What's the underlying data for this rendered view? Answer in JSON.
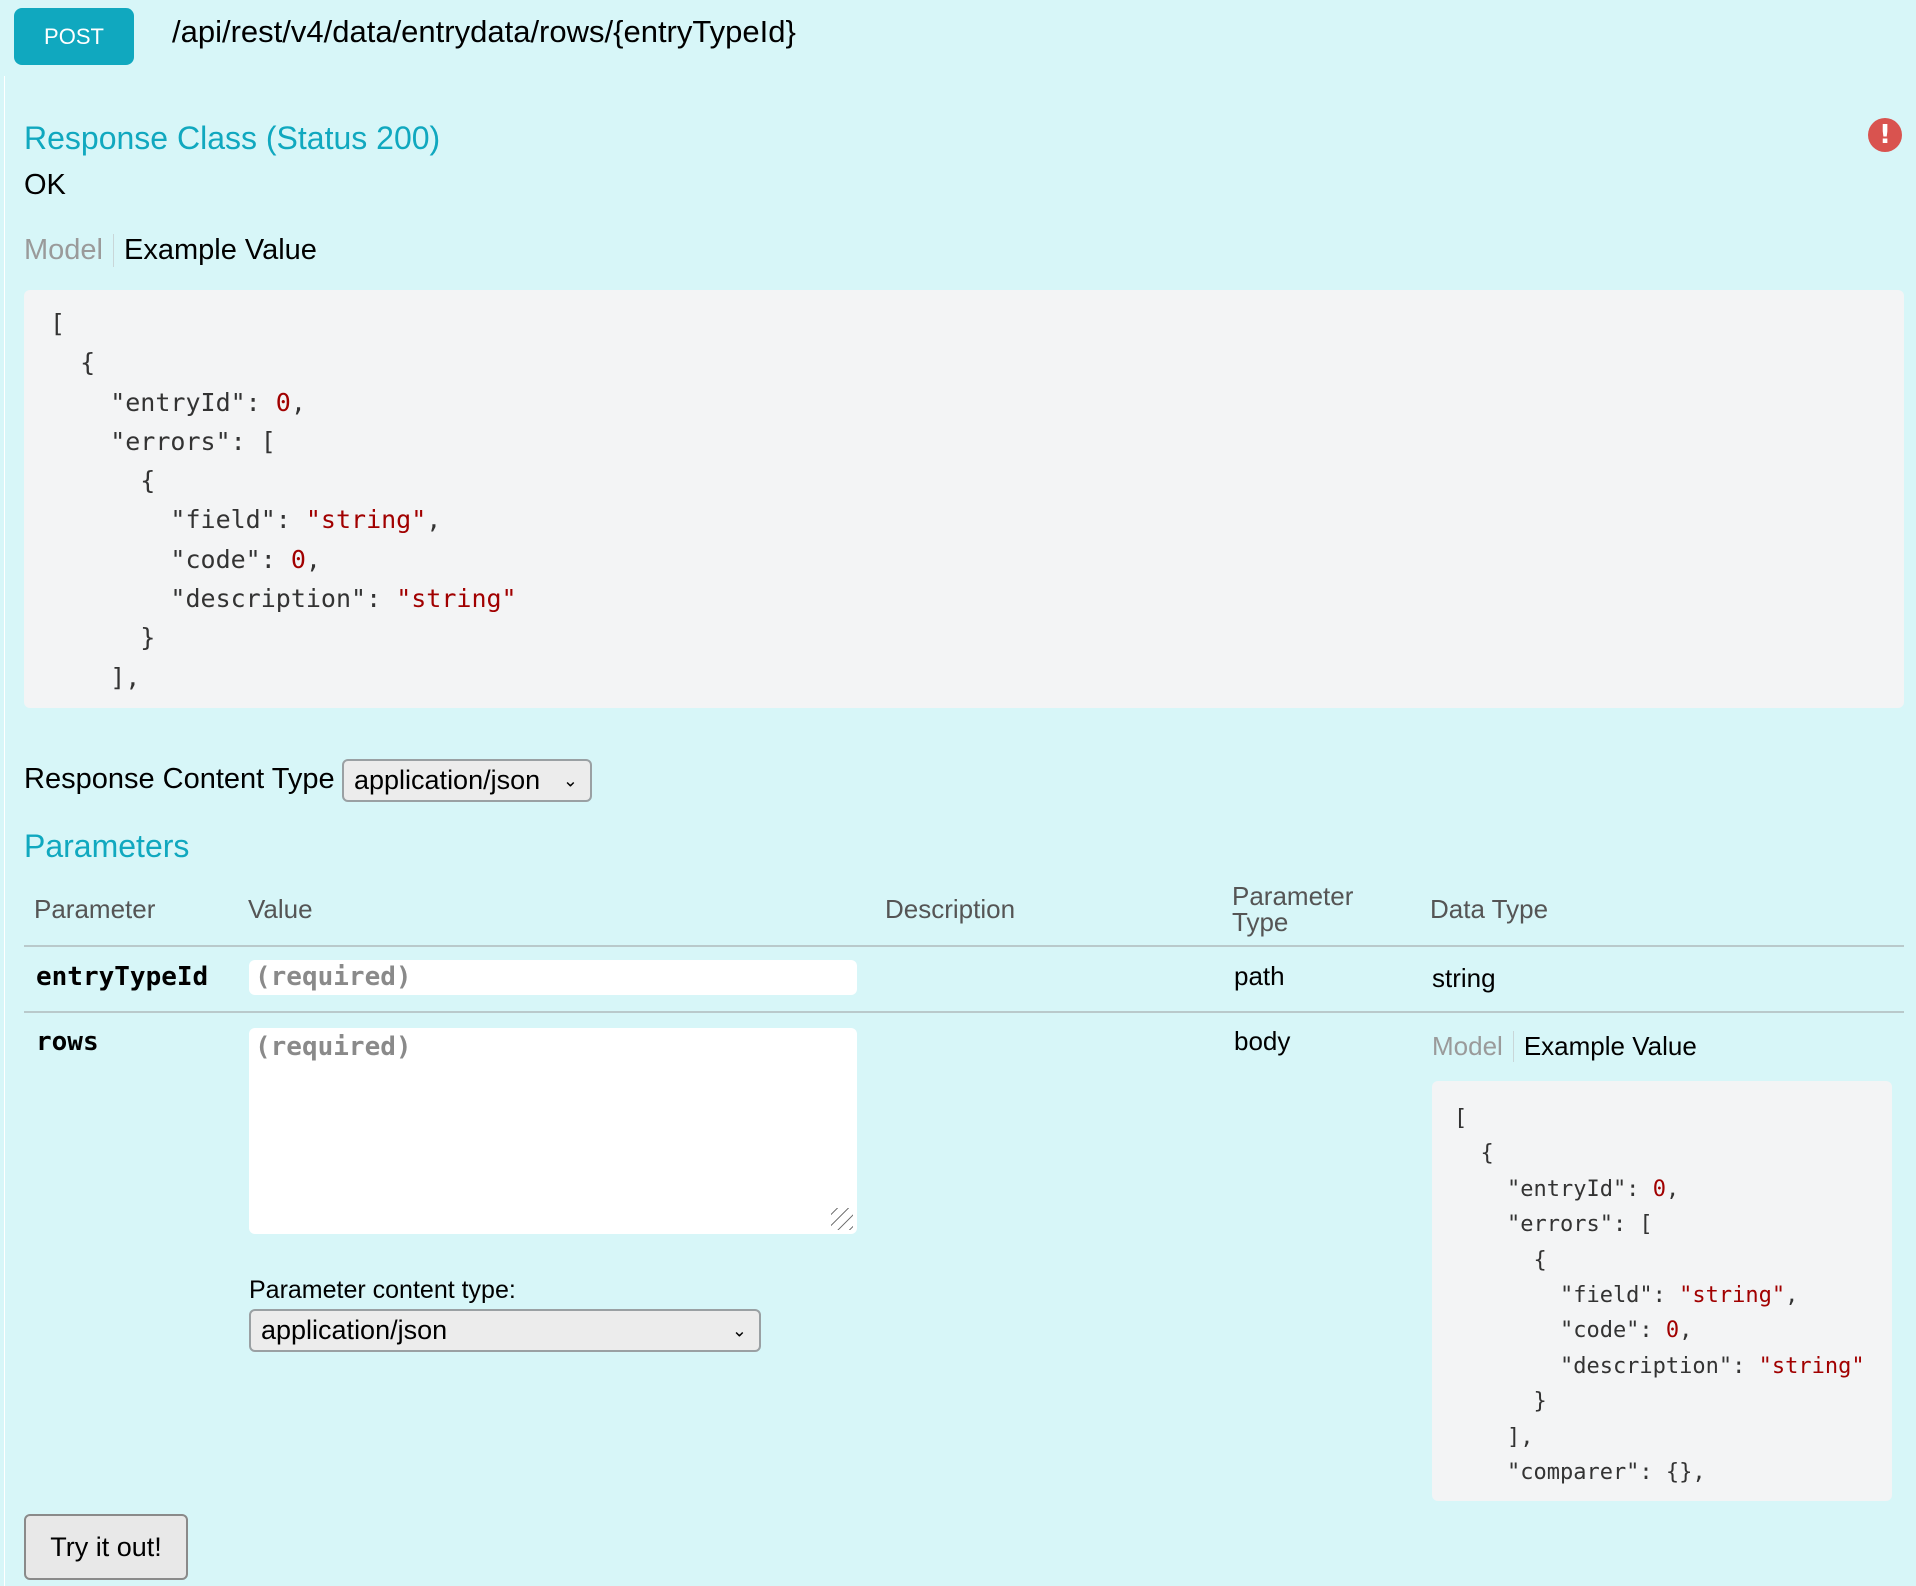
{
  "endpoint": {
    "method": "POST",
    "path": "/api/rest/v4/data/entrydata/rows/{entryTypeId}"
  },
  "response": {
    "heading": "Response Class (Status 200)",
    "status_text": "OK",
    "tabs": [
      "Model",
      "Example Value"
    ],
    "example_lines": [
      "[",
      "  {",
      "    \"entryId\": 0,",
      "    \"errors\": [",
      "      {",
      "        \"field\": \"string\",",
      "        \"code\": 0,",
      "        \"description\": \"string\"",
      "      }",
      "    ],"
    ]
  },
  "response_content_type": {
    "label": "Response Content Type",
    "selected": "application/json"
  },
  "parameters": {
    "heading": "Parameters",
    "columns": [
      "Parameter",
      "Value",
      "Description",
      "Parameter Type",
      "Data Type"
    ],
    "rows": [
      {
        "name": "entryTypeId",
        "placeholder": "(required)",
        "type": "path",
        "data_type": "string"
      },
      {
        "name": "rows",
        "placeholder": "(required)",
        "type": "body"
      }
    ],
    "content_type_label": "Parameter content type:",
    "content_type_selected": "application/json",
    "data_type_tabs": [
      "Model",
      "Example Value"
    ],
    "example_lines": [
      "[",
      "  {",
      "    \"entryId\": 0,",
      "    \"errors\": [",
      "      {",
      "        \"field\": \"string\",",
      "        \"code\": 0,",
      "        \"description\": \"string\"",
      "      }",
      "    ],",
      "    \"comparer\": {},"
    ]
  },
  "try_button": "Try it out!",
  "colors": {
    "accent": "#10a8bf",
    "background": "#d7f6f8",
    "string_literal": "#a10000"
  }
}
